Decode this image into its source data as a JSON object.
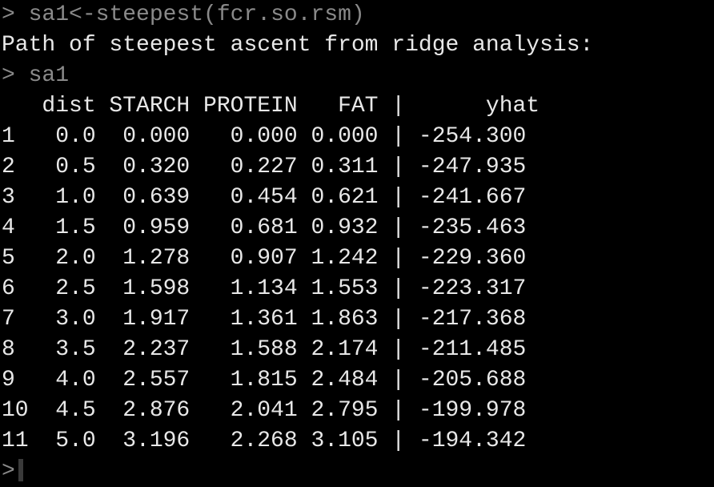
{
  "console": {
    "prompt": ">",
    "command1": "sa1<-steepest(fcr.so.rsm)",
    "message": "Path of steepest ascent from ridge analysis:",
    "command2": "sa1",
    "header": "   dist STARCH PROTEIN   FAT |      yhat",
    "rows": [
      "1   0.0  0.000   0.000 0.000 | -254.300",
      "2   0.5  0.320   0.227 0.311 | -247.935",
      "3   1.0  0.639   0.454 0.621 | -241.667",
      "4   1.5  0.959   0.681 0.932 | -235.463",
      "5   2.0  1.278   0.907 1.242 | -229.360",
      "6   2.5  1.598   1.134 1.553 | -223.317",
      "7   3.0  1.917   1.361 1.863 | -217.368",
      "8   3.5  2.237   1.588 2.174 | -211.485",
      "9   4.0  2.557   1.815 2.484 | -205.688",
      "10  4.5  2.876   2.041 2.795 | -199.978",
      "11  5.0  3.196   2.268 3.105 | -194.342"
    ]
  }
}
